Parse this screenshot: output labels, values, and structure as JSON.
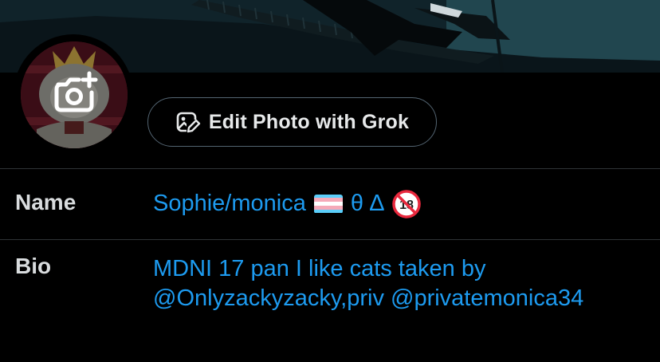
{
  "profile_editor": {
    "banner": {
      "icon": "banner-artwork"
    },
    "avatar": {
      "icon": "avatar-artwork",
      "change_photo_icon": "camera-plus-icon"
    },
    "grok_button": {
      "label": "Edit Photo with Grok",
      "icon": "image-edit-icon"
    },
    "fields": {
      "name": {
        "label": "Name",
        "value_text": "Sophie/monica",
        "symbols": "θ ∆",
        "flag_icon": "transgender-flag-icon",
        "badge_icon": "no-under-18-icon",
        "badge_text": "18"
      },
      "bio": {
        "label": "Bio",
        "line1": "MDNI 17 pan I like cats taken by",
        "line2": "@Onlyzackyzacky,priv @privatemonica34"
      }
    },
    "colors": {
      "accent": "#1d9bf0",
      "background": "#000000",
      "divider": "#2f3336",
      "flag": [
        "#5bcefa",
        "#f5a9b8",
        "#ffffff",
        "#f5a9b8",
        "#5bcefa"
      ],
      "badge": "#e8283d"
    }
  }
}
